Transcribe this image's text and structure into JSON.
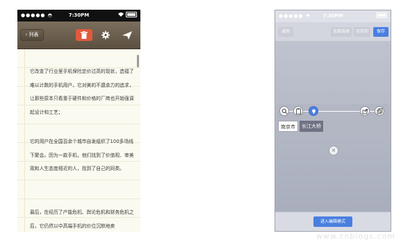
{
  "left_phone": {
    "status": {
      "time": "7:30PM"
    },
    "navbar": {
      "back_label": "列表"
    },
    "paragraphs": [
      "它改变了行业里手机保险定价过高的现状，造福了难以计数的手机用户，它对美的不遗余力的追求，让那些原本只看重于硬件和价格的厂商也开始强调起设计和工艺；",
      "它的用户在全国百余个城市自发组织了100多场线下聚会。因为一款手机，他们找到了价值观、审美观和人生态度相近的人，找到了自己的同类。",
      "最后，在经历了产能危机、舆论危机和财务危机之后，它仍然以中高端手机的价位沉默地卖"
    ]
  },
  "right_phone": {
    "status": {
      "time": "7:30PM"
    },
    "navbar": {
      "back_label": "返回",
      "select_all_label": "全部选择",
      "save_as_label": "另存到",
      "save_label": "保存"
    },
    "chips": {
      "selected": "南京市",
      "other": "长江大桥"
    },
    "close_symbol": "×",
    "bottom_button": "进入编辑模式"
  },
  "watermark": "www.cnblogs.com",
  "colors": {
    "accent_blue": "#4a7fe0",
    "delete_red": "#e15a3c",
    "nav_brown": "#6d6050"
  }
}
